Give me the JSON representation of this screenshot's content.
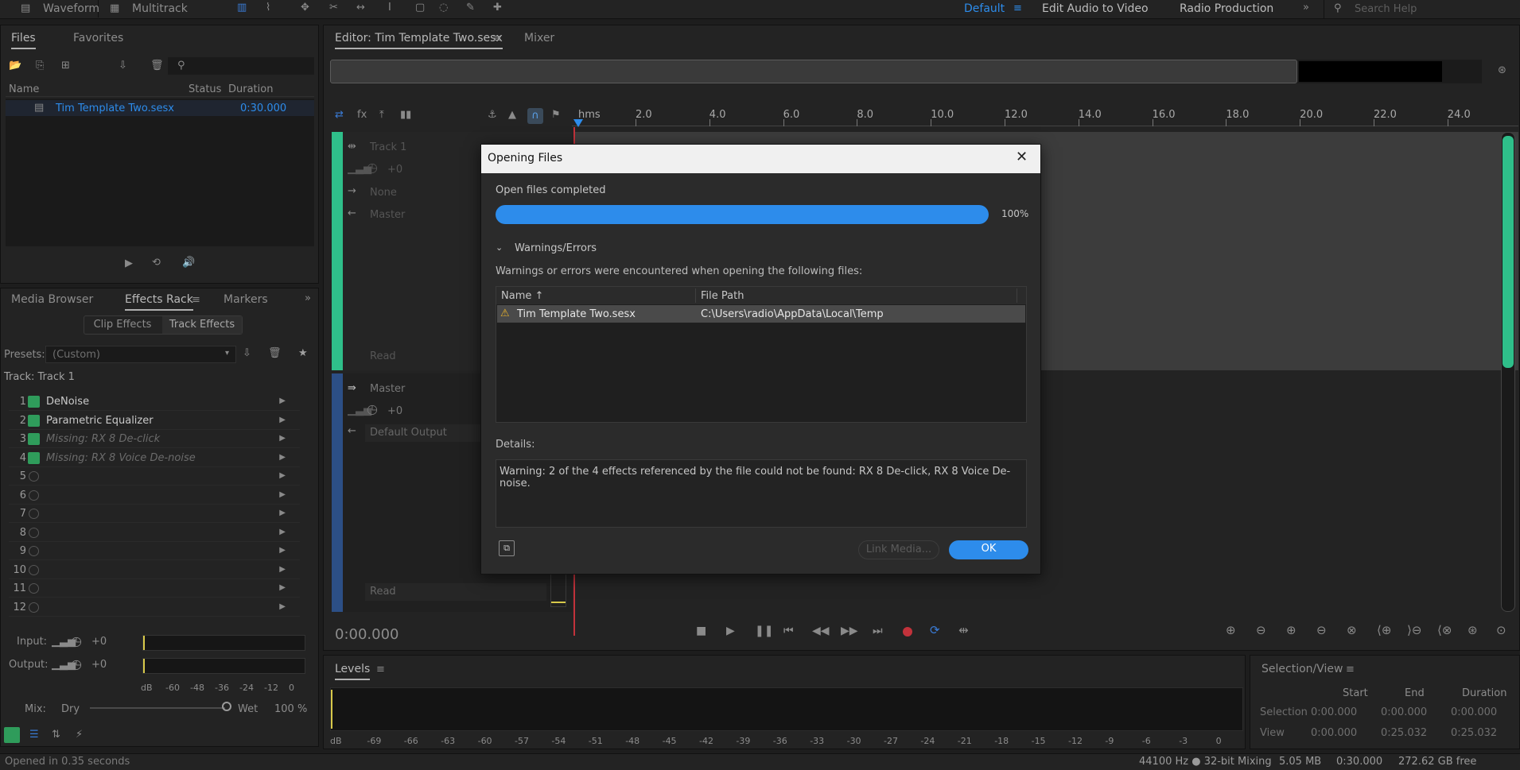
{
  "toolbar": {
    "mode_waveform": "Waveform",
    "mode_multitrack": "Multitrack",
    "workspaces": [
      "Default",
      "Edit Audio to Video",
      "Radio Production"
    ],
    "search_placeholder": "Search Help"
  },
  "files_panel": {
    "tabs": [
      "Files",
      "Favorites"
    ],
    "columns": [
      "Name",
      "Status",
      "Duration"
    ],
    "file_name": "Tim Template Two.sesx",
    "file_duration": "0:30.000"
  },
  "effects_panel": {
    "tabs": [
      "Media Browser",
      "Effects Rack",
      "Markers"
    ],
    "sub_tabs": [
      "Clip Effects",
      "Track Effects"
    ],
    "presets_label": "Presets:",
    "presets_value": "(Custom)",
    "track_label": "Track: Track 1",
    "rows": [
      {
        "num": "1",
        "name": "DeNoise",
        "on": true,
        "missing": false
      },
      {
        "num": "2",
        "name": "Parametric Equalizer",
        "on": true,
        "missing": false
      },
      {
        "num": "3",
        "name": "Missing: RX 8 De-click",
        "on": true,
        "missing": true
      },
      {
        "num": "4",
        "name": "Missing: RX 8 Voice De-noise",
        "on": true,
        "missing": true
      },
      {
        "num": "5",
        "name": "",
        "on": false,
        "missing": false
      },
      {
        "num": "6",
        "name": "",
        "on": false,
        "missing": false
      },
      {
        "num": "7",
        "name": "",
        "on": false,
        "missing": false
      },
      {
        "num": "8",
        "name": "",
        "on": false,
        "missing": false
      },
      {
        "num": "9",
        "name": "",
        "on": false,
        "missing": false
      },
      {
        "num": "10",
        "name": "",
        "on": false,
        "missing": false
      },
      {
        "num": "11",
        "name": "",
        "on": false,
        "missing": false
      },
      {
        "num": "12",
        "name": "",
        "on": false,
        "missing": false
      }
    ],
    "input_label": "Input:",
    "input_value": "+0",
    "output_label": "Output:",
    "output_value": "+0",
    "meter_scale": [
      "dB",
      "-60",
      "-48",
      "-36",
      "-24",
      "-12",
      "0"
    ],
    "mix_label": "Mix:",
    "mix_dry": "Dry",
    "mix_wet": "Wet",
    "mix_value": "100 %"
  },
  "editor": {
    "tab_editor": "Editor: Tim Template Two.sesx",
    "tab_mixer": "Mixer",
    "ruler_unit": "hms",
    "ruler_ticks": [
      "2.0",
      "4.0",
      "6.0",
      "8.0",
      "10.0",
      "12.0",
      "14.0",
      "16.0",
      "18.0",
      "20.0",
      "22.0",
      "24.0"
    ],
    "track1_name": "Track 1",
    "track1_volume": "+0",
    "track1_input": "None",
    "track1_output": "Master",
    "track1_automation": "Read",
    "master_name": "Master",
    "master_volume": "+0",
    "master_output": "Default Output",
    "master_automation": "Read",
    "time_display": "0:00.000"
  },
  "levels_panel": {
    "title": "Levels",
    "scale": [
      "dB",
      "-69",
      "-66",
      "-63",
      "-60",
      "-57",
      "-54",
      "-51",
      "-48",
      "-45",
      "-42",
      "-39",
      "-36",
      "-33",
      "-30",
      "-27",
      "-24",
      "-21",
      "-18",
      "-15",
      "-12",
      "-9",
      "-6",
      "-3",
      "0"
    ]
  },
  "selection_panel": {
    "title": "Selection/View",
    "columns": [
      "Start",
      "End",
      "Duration"
    ],
    "selection_label": "Selection",
    "selection_values": [
      "0:00.000",
      "0:00.000",
      "0:00.000"
    ],
    "view_label": "View",
    "view_values": [
      "0:00.000",
      "0:25.032",
      "0:25.032"
    ]
  },
  "dialog": {
    "title": "Opening Files",
    "status": "Open files completed",
    "progress": 1.0,
    "progress_text": "100%",
    "section_title": "Warnings/Errors",
    "section_desc": "Warnings or errors were encountered when opening the following files:",
    "table_headers": [
      "Name",
      "File Path"
    ],
    "rows": [
      {
        "name": "Tim Template Two.sesx",
        "path": "C:\\Users\\radio\\AppData\\Local\\Temp"
      }
    ],
    "details_label": "Details:",
    "details_text": "Warning: 2 of the 4 effects referenced by the file could not be found: RX 8 De-click, RX 8 Voice De-noise.",
    "link_media_label": "Link Media...",
    "ok_label": "OK"
  },
  "status_bar": {
    "message": "Opened in 0.35 seconds",
    "sample_info": "44100 Hz ● 32-bit Mixing",
    "memory": "5.05 MB",
    "duration": "0:30.000",
    "disk_free": "272.62 GB free"
  },
  "colors": {
    "accent_blue": "#2d8ceb",
    "track_green": "#2fbf8a",
    "master_blue": "#2c4f86",
    "playhead_red": "#c2323b"
  }
}
